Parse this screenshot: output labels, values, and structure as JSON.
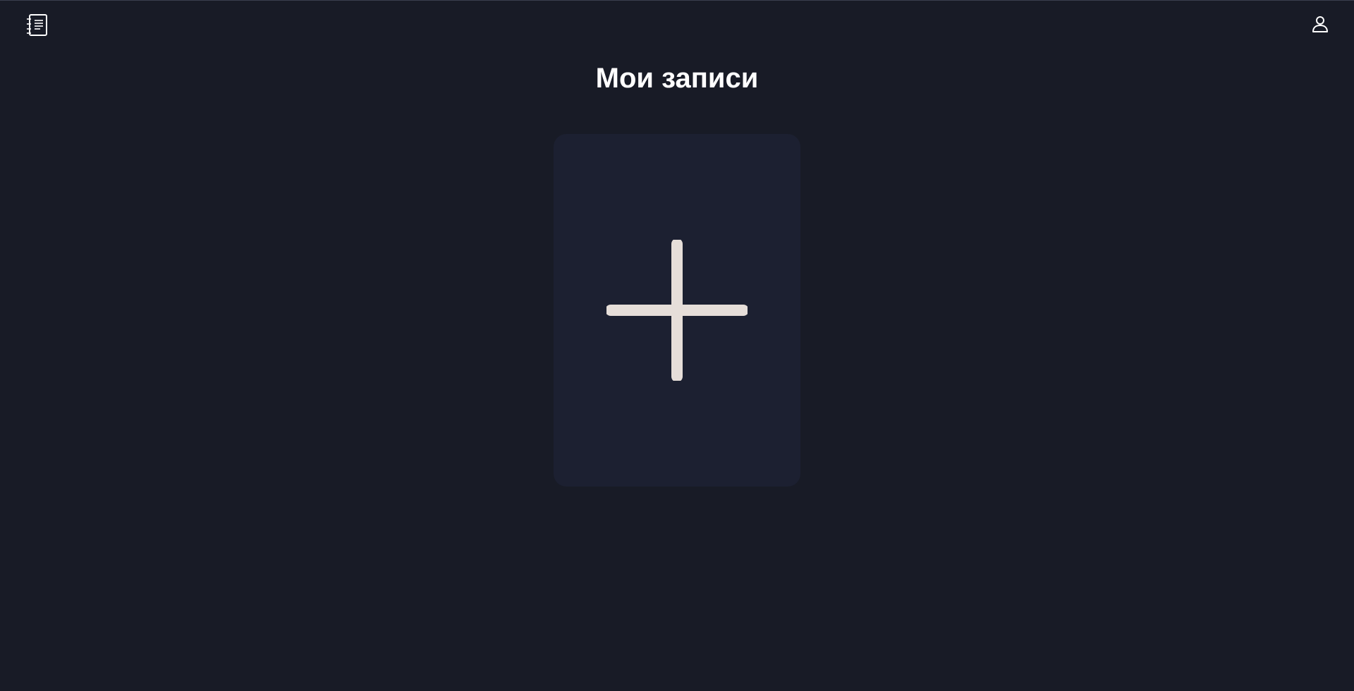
{
  "header": {
    "logo_icon": "notebook-icon",
    "profile_icon": "user-icon"
  },
  "main": {
    "title": "Мои записи",
    "add_card_icon": "plus-icon"
  },
  "colors": {
    "background": "#181b26",
    "card": "#1c2031",
    "plus": "#e6ded9",
    "text": "#ffffff"
  }
}
